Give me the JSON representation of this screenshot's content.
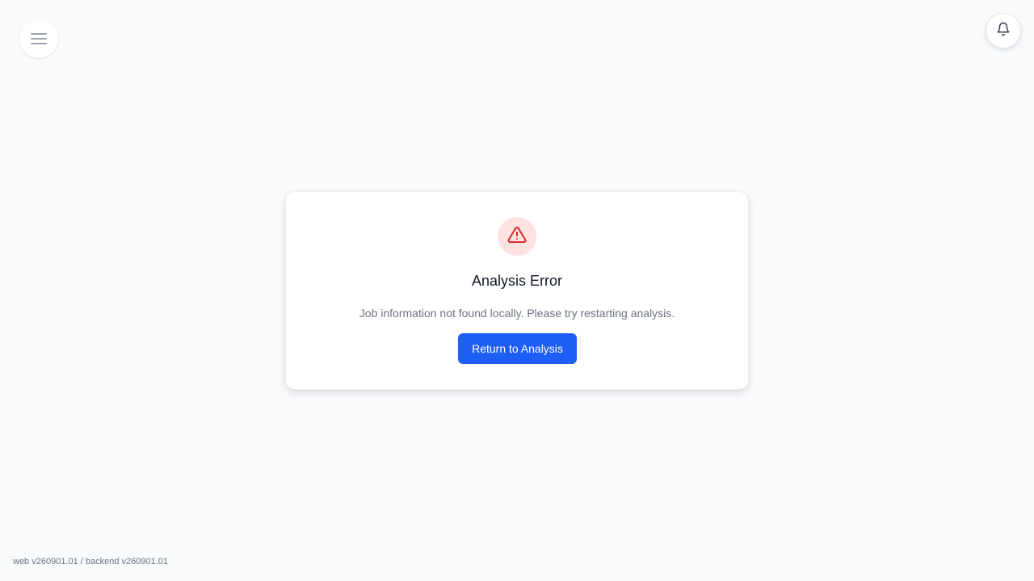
{
  "header": {
    "menu_icon": "hamburger-menu-icon",
    "notification_icon": "bell-icon"
  },
  "error_card": {
    "icon": "warning-triangle-icon",
    "title": "Analysis Error",
    "message": "Job information not found locally. Please try restarting analysis.",
    "button_label": "Return to Analysis"
  },
  "footer": {
    "version": "web v260901.01 / backend v260901.01"
  },
  "colors": {
    "background": "#f8fafc",
    "primary": "#1d5ef5",
    "error": "#dc2626",
    "error_bg": "#fee2e2"
  }
}
